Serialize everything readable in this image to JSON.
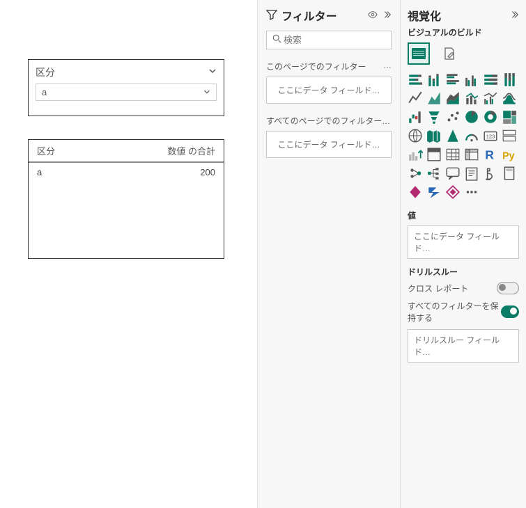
{
  "canvas": {
    "slicer": {
      "title": "区分",
      "value": "a"
    },
    "table": {
      "cols": [
        "区分",
        "数値 の合計"
      ],
      "rows": [
        {
          "c0": "a",
          "c1": "200"
        }
      ]
    }
  },
  "filters": {
    "title": "フィルター",
    "search_placeholder": "検索",
    "page_label": "このページでのフィルター",
    "all_label": "すべてのページでのフィルター…",
    "drop_text": "ここにデータ フィールド…",
    "ell": "…"
  },
  "viz": {
    "title": "視覚化",
    "build_label": "ビジュアルのビルド",
    "value_label": "値",
    "drop_text": "ここにデータ フィールド…",
    "drill_label": "ドリルスルー",
    "cross_label": "クロス レポート",
    "keep_label": "すべてのフィルターを保持する",
    "drill_drop": "ドリルスルー フィールド…"
  }
}
